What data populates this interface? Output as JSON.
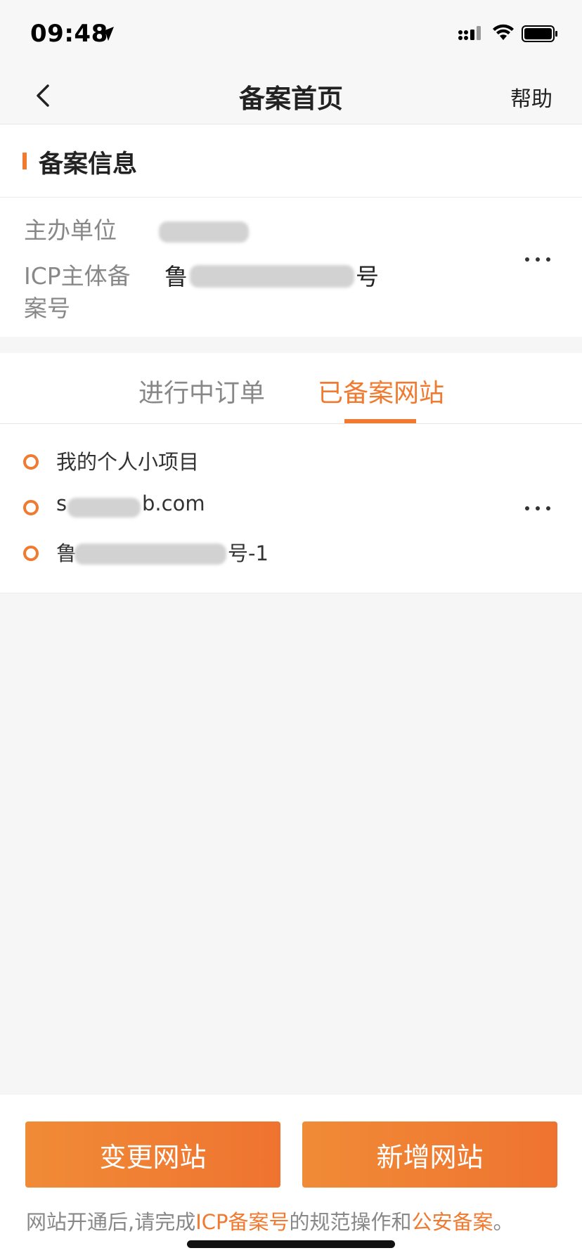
{
  "status_bar": {
    "time": "09:48"
  },
  "nav": {
    "title": "备案首页",
    "help": "帮助"
  },
  "info": {
    "section_title": "备案信息",
    "org_label": "主办单位",
    "icp_label_line1": "ICP主体备",
    "icp_label_line2": "案号",
    "icp_value_prefix": "鲁",
    "icp_value_suffix": "号"
  },
  "tabs": [
    {
      "label": "进行中订单",
      "active": false
    },
    {
      "label": "已备案网站",
      "active": true
    }
  ],
  "sites": [
    {
      "text": "我的个人小项目"
    },
    {
      "text_prefix": "s",
      "text_suffix": "b.com"
    },
    {
      "text_prefix": "鲁",
      "text_suffix": "号-1"
    }
  ],
  "footer": {
    "change_button": "变更网站",
    "add_button": "新增网站",
    "note_part1": "网站开通后,请完成",
    "note_link1": "ICP备案号",
    "note_part2": "的规范操作和",
    "note_link2": "公安备案",
    "note_part3": "。"
  },
  "colors": {
    "accent": "#ef7a30",
    "background": "#f6f6f6"
  },
  "icons": [
    "location-arrow-icon",
    "signal-icon",
    "wifi-icon",
    "battery-icon",
    "back-chevron-icon",
    "more-icon"
  ]
}
